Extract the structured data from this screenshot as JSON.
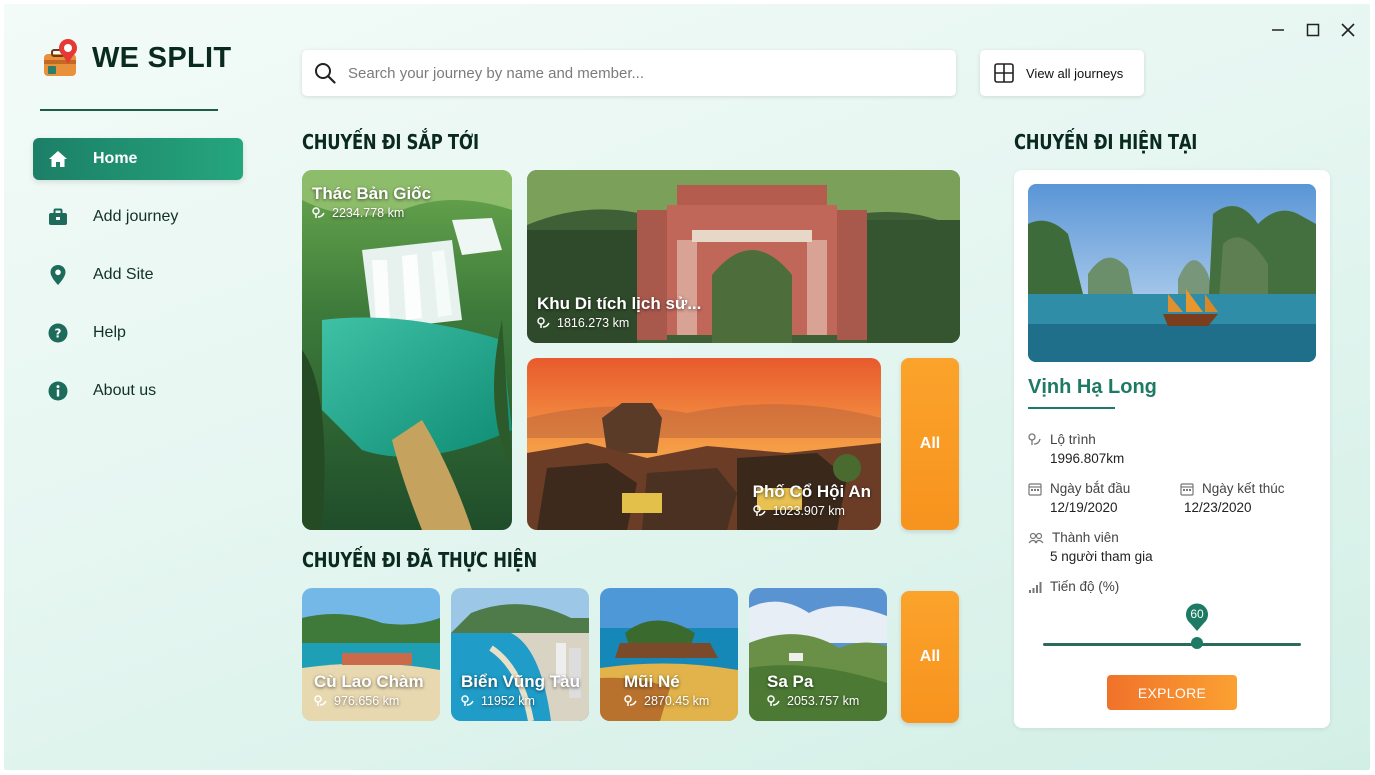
{
  "app": {
    "title": "WE SPLIT"
  },
  "window_controls": {
    "minimize_icon": "minimize-icon",
    "maximize_icon": "maximize-icon",
    "close_icon": "close-icon"
  },
  "sidebar": {
    "items": [
      {
        "label": "Home",
        "icon": "home-icon",
        "active": true
      },
      {
        "label": "Add journey",
        "icon": "briefcase-icon",
        "active": false
      },
      {
        "label": "Add Site",
        "icon": "map-pin-icon",
        "active": false
      },
      {
        "label": "Help",
        "icon": "help-icon",
        "active": false
      },
      {
        "label": "About us",
        "icon": "info-icon",
        "active": false
      }
    ]
  },
  "search": {
    "placeholder": "Search your journey by name and member...",
    "value": ""
  },
  "view_all": {
    "label": "View all journeys"
  },
  "upcoming": {
    "title": "CHUYẾN ĐI SẮP TỚI",
    "cards": [
      {
        "name": "Thác Bản Giốc",
        "distance": "2234.778 km"
      },
      {
        "name": "Khu Di tích lịch sử...",
        "distance": "1816.273 km"
      },
      {
        "name": "Phố Cổ Hội An",
        "distance": "1023.907 km"
      }
    ],
    "all_label": "All"
  },
  "completed": {
    "title": "CHUYẾN ĐI ĐÃ THỰC HIỆN",
    "cards": [
      {
        "name": "Cù Lao Chàm",
        "distance": "976.656 km"
      },
      {
        "name": "Biển Vũng Tàu",
        "distance": "11952 km"
      },
      {
        "name": "Mũi Né",
        "distance": "2870.45 km"
      },
      {
        "name": "Sa Pa",
        "distance": "2053.757 km"
      }
    ],
    "all_label": "All"
  },
  "current": {
    "title": "CHUYẾN ĐI HIỆN TẠI",
    "name": "Vịnh Hạ Long",
    "route_label": "Lộ trình",
    "route_value": "1996.807km",
    "start_label": "Ngày bắt đầu",
    "start_value": "12/19/2020",
    "end_label": "Ngày kết thúc",
    "end_value": "12/23/2020",
    "members_label": "Thành viên",
    "members_value": "5 người tham gia",
    "progress_label": "Tiến độ (%)",
    "progress_value": "60",
    "explore_label": "EXPLORE"
  },
  "colors": {
    "accent": "#1d7a64",
    "orange": "#f7931e",
    "text_dark": "#0b2a1f"
  }
}
